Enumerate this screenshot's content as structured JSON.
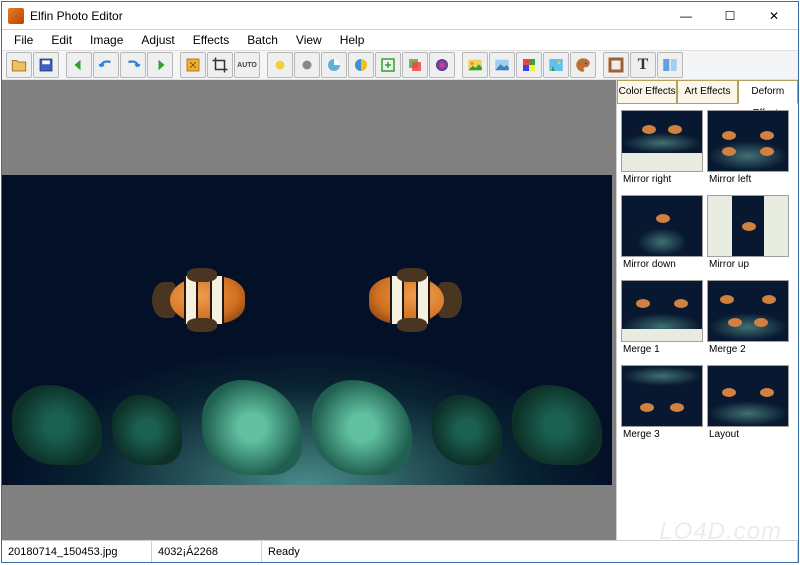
{
  "window": {
    "title": "Elfin Photo Editor"
  },
  "menu": {
    "file": "File",
    "edit": "Edit",
    "image": "Image",
    "adjust": "Adjust",
    "effects": "Effects",
    "batch": "Batch",
    "view": "View",
    "help": "Help"
  },
  "toolbar_icons": [
    "open",
    "save",
    "back",
    "undo",
    "redo",
    "forward",
    "fit",
    "crop",
    "auto",
    "bright",
    "dim",
    "pie",
    "half",
    "add-layer",
    "layers",
    "color",
    "pic1",
    "pic2",
    "swatch",
    "palm",
    "palette",
    "frame",
    "text",
    "panels"
  ],
  "sidebar": {
    "tabs": {
      "color": "Color Effects",
      "art": "Art Effects",
      "deform": "Deform Effects"
    },
    "active_tab": "deform",
    "effects": [
      {
        "id": "mirror-right",
        "label": "Mirror right"
      },
      {
        "id": "mirror-left",
        "label": "Mirror left"
      },
      {
        "id": "mirror-down",
        "label": "Mirror down"
      },
      {
        "id": "mirror-up",
        "label": "Mirror up"
      },
      {
        "id": "merge-1",
        "label": "Merge 1"
      },
      {
        "id": "merge-2",
        "label": "Merge 2"
      },
      {
        "id": "merge-3",
        "label": "Merge 3"
      },
      {
        "id": "layout",
        "label": "Layout"
      }
    ]
  },
  "status": {
    "filename": "20180714_150453.jpg",
    "dimensions": "4032¡Á2268",
    "state": "Ready"
  },
  "watermark": "LO4D.com"
}
